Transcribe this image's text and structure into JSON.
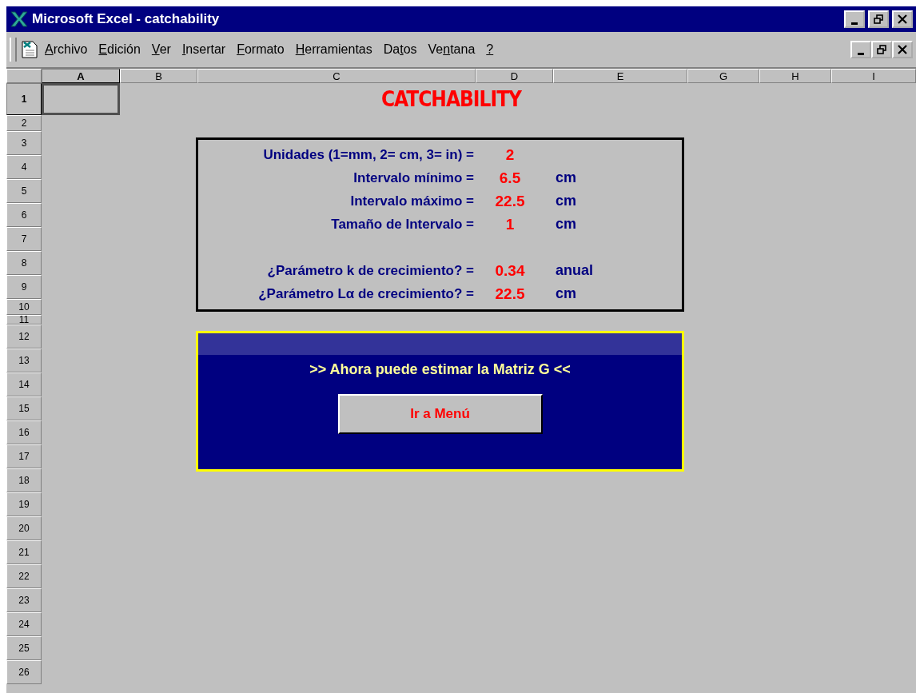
{
  "window": {
    "title": "Microsoft Excel - catchability"
  },
  "menu": [
    {
      "key": "A",
      "post": "rchivo"
    },
    {
      "key": "E",
      "post": "dición"
    },
    {
      "key": "V",
      "post": "er"
    },
    {
      "key": "I",
      "post": "nsertar"
    },
    {
      "key": "F",
      "post": "ormato"
    },
    {
      "key": "H",
      "post": "erramientas"
    },
    {
      "pre": "Da",
      "key": "t",
      "post": "os"
    },
    {
      "pre": "Ve",
      "key": "n",
      "post": "tana"
    },
    {
      "key": "?"
    }
  ],
  "columns": [
    {
      "label": "A",
      "selected": true
    },
    {
      "label": "B",
      "selected": false
    },
    {
      "label": "C",
      "selected": false
    },
    {
      "label": "D",
      "selected": false
    },
    {
      "label": "E",
      "selected": false
    },
    {
      "label": "G",
      "selected": false
    },
    {
      "label": "H",
      "selected": false
    },
    {
      "label": "I",
      "selected": false
    }
  ],
  "rows": [
    {
      "label": "1",
      "selected": true
    },
    {
      "label": "2",
      "selected": false
    },
    {
      "label": "3",
      "selected": false
    },
    {
      "label": "4",
      "selected": false
    },
    {
      "label": "5",
      "selected": false
    },
    {
      "label": "6",
      "selected": false
    },
    {
      "label": "7",
      "selected": false
    },
    {
      "label": "8",
      "selected": false
    },
    {
      "label": "9",
      "selected": false
    },
    {
      "label": "10",
      "selected": false
    },
    {
      "label": "11",
      "selected": false
    },
    {
      "label": "12",
      "selected": false
    },
    {
      "label": "13",
      "selected": false
    },
    {
      "label": "14",
      "selected": false
    },
    {
      "label": "15",
      "selected": false
    },
    {
      "label": "16",
      "selected": false
    },
    {
      "label": "17",
      "selected": false
    },
    {
      "label": "18",
      "selected": false
    },
    {
      "label": "19",
      "selected": false
    },
    {
      "label": "20",
      "selected": false
    },
    {
      "label": "21",
      "selected": false
    },
    {
      "label": "22",
      "selected": false
    },
    {
      "label": "23",
      "selected": false
    },
    {
      "label": "24",
      "selected": false
    },
    {
      "label": "25",
      "selected": false
    },
    {
      "label": "26",
      "selected": false
    }
  ],
  "sheet_title": "CATCHABILITY",
  "parameter_groups": [
    [
      {
        "label": "Unidades (1=mm, 2= cm, 3= in) =",
        "value": "2"
      },
      {
        "label": "Intervalo mínimo =",
        "value": "6.5",
        "unit": "cm"
      },
      {
        "label": "Intervalo máximo =",
        "value": "22.5",
        "unit": "cm"
      },
      {
        "label": "Tamaño de Intervalo =",
        "value": "1",
        "unit": "cm"
      }
    ],
    [
      {
        "label": "¿Parámetro  k de crecimiento? =",
        "value": "0.34",
        "unit": "anual"
      },
      {
        "label": "¿Parámetro  Lα de crecimiento? =",
        "value": "22.5",
        "unit": "cm"
      }
    ]
  ],
  "panel": {
    "message": ">> Ahora puede estimar la Matriz G <<",
    "button": "Ir a Menú"
  }
}
